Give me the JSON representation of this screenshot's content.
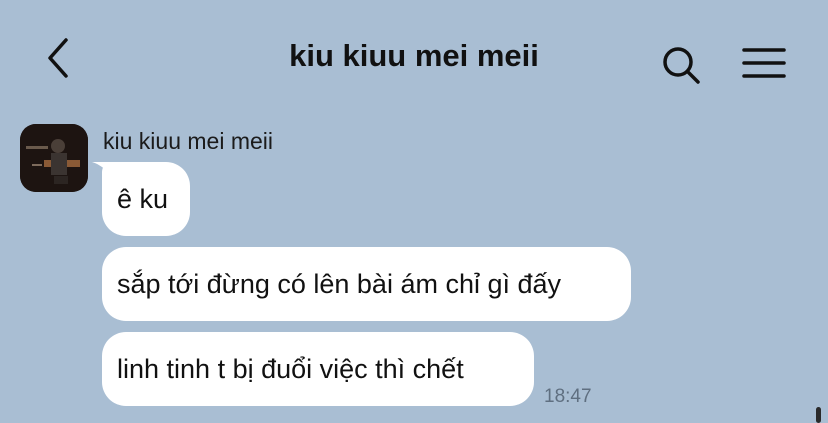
{
  "header": {
    "title": "kiu kiuu mei meii",
    "back_icon": "back-chevron-icon",
    "search_icon": "search-icon",
    "menu_icon": "menu-icon"
  },
  "chat": {
    "sender_name": "kiu kiuu mei meii",
    "messages": [
      {
        "text": "ê ku"
      },
      {
        "text": "sắp tới đừng có lên bài ám chỉ gì đấy"
      },
      {
        "text": "linh tinh t bị đuổi việc thì chết"
      }
    ],
    "timestamp": "18:47"
  },
  "colors": {
    "background": "#a9bed3",
    "bubble": "#ffffff",
    "timestamp": "#5f6f80"
  }
}
